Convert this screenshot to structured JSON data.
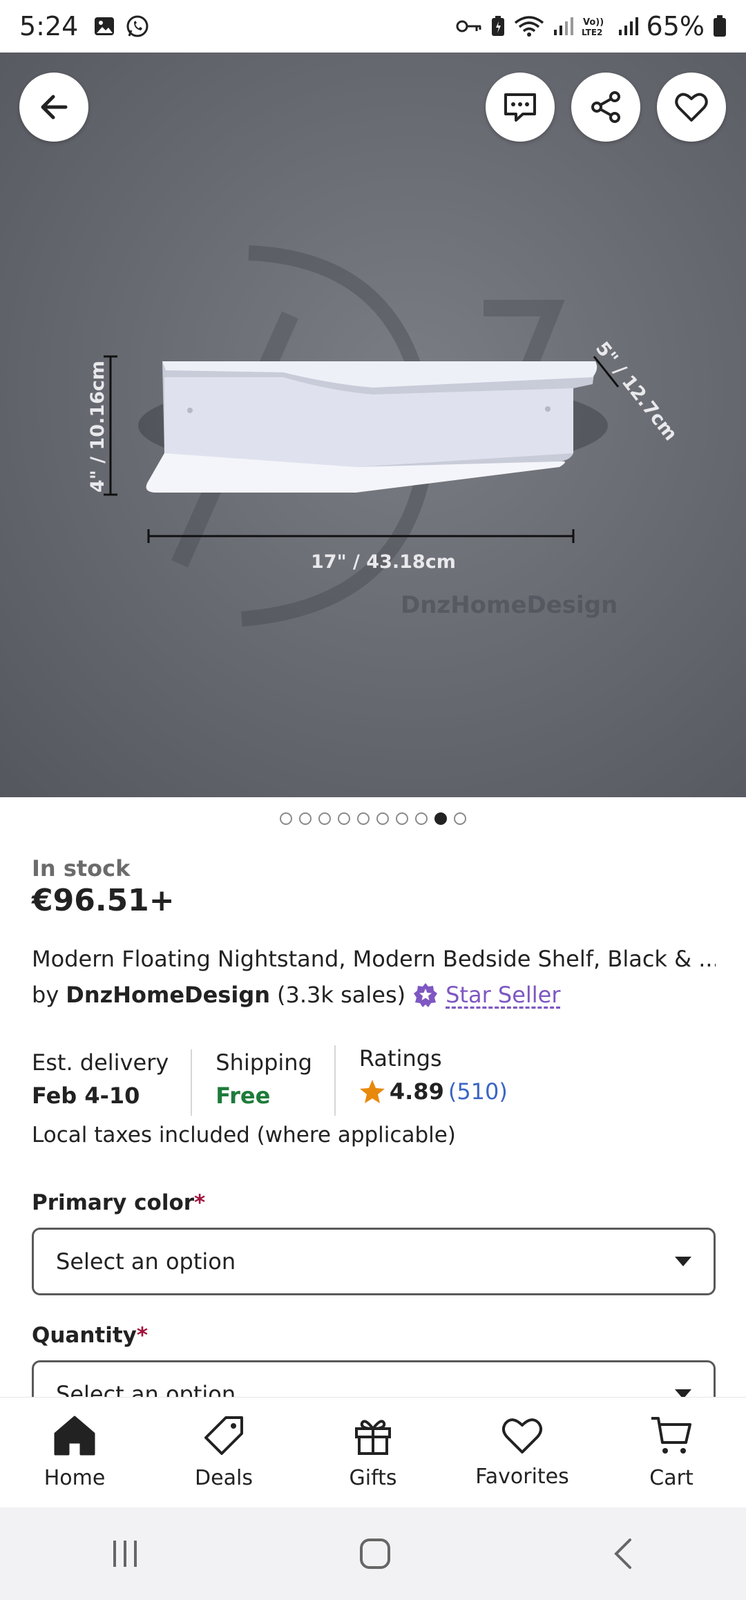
{
  "status_bar": {
    "time": "5:24",
    "battery": "65%"
  },
  "hero": {
    "dim_height": "4\" / 10.16cm",
    "dim_width": "17\" / 43.18cm",
    "dim_depth": "5\" / 12.7cm",
    "watermark": "DnzHomeDesign",
    "image_count": 10,
    "active_image_index": 8
  },
  "listing": {
    "stock": "In stock",
    "price": "€96.51+",
    "title": "Modern Floating Nightstand, Modern Bedside Shelf, Black & ...",
    "by": "by",
    "shop": "DnzHomeDesign",
    "sales": "(3.3k sales)",
    "star_seller": "Star Seller",
    "delivery_label": "Est. delivery",
    "delivery_value": "Feb 4-10",
    "shipping_label": "Shipping",
    "shipping_value": "Free",
    "ratings_label": "Ratings",
    "rating_value": "4.89",
    "rating_count": "(510)",
    "taxes": "Local taxes included (where applicable)"
  },
  "options": {
    "color_label": "Primary color",
    "quantity_label": "Quantity",
    "required_mark": "*",
    "select_placeholder": "Select an option"
  },
  "bottom_nav": [
    "Home",
    "Deals",
    "Gifts",
    "Favorites",
    "Cart"
  ],
  "colors": {
    "free": "#1e7b3a",
    "star_seller": "#7e57c2",
    "rating_star": "#e8890c",
    "required": "#a0123b"
  }
}
